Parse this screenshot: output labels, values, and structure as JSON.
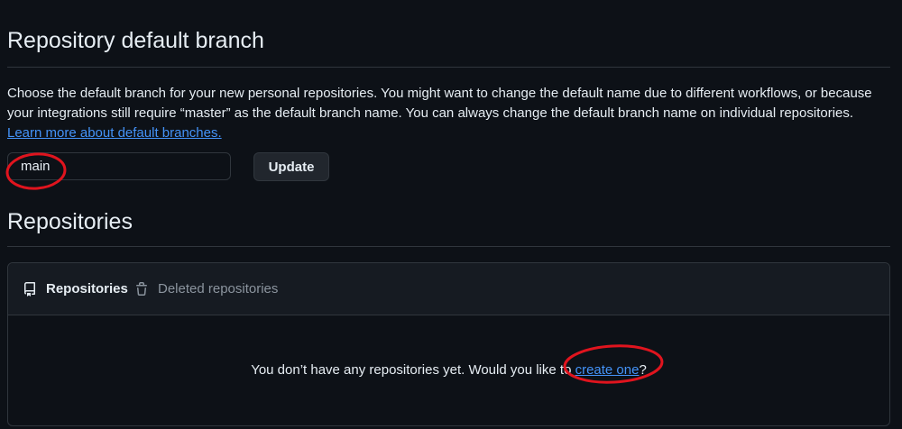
{
  "default_branch": {
    "title": "Repository default branch",
    "description": "Choose the default branch for your new personal repositories. You might want to change the default name due to different workflows, or because your integrations still require “master” as the default branch name. You can always change the default branch name on individual repositories.",
    "learn_more_link": "Learn more about default branches.",
    "input_value": "main",
    "update_button": "Update"
  },
  "repositories": {
    "title": "Repositories",
    "tabs": [
      {
        "label": "Repositories",
        "icon": "repo-icon",
        "active": true
      },
      {
        "label": "Deleted repositories",
        "icon": "trash-icon",
        "active": false
      }
    ],
    "empty_text": "You don’t have any repositories yet. Would you like to",
    "empty_link": "create one",
    "empty_suffix": "?"
  },
  "colors": {
    "background": "#0d1117",
    "link": "#4493f8",
    "annotation": "#e0141e"
  }
}
